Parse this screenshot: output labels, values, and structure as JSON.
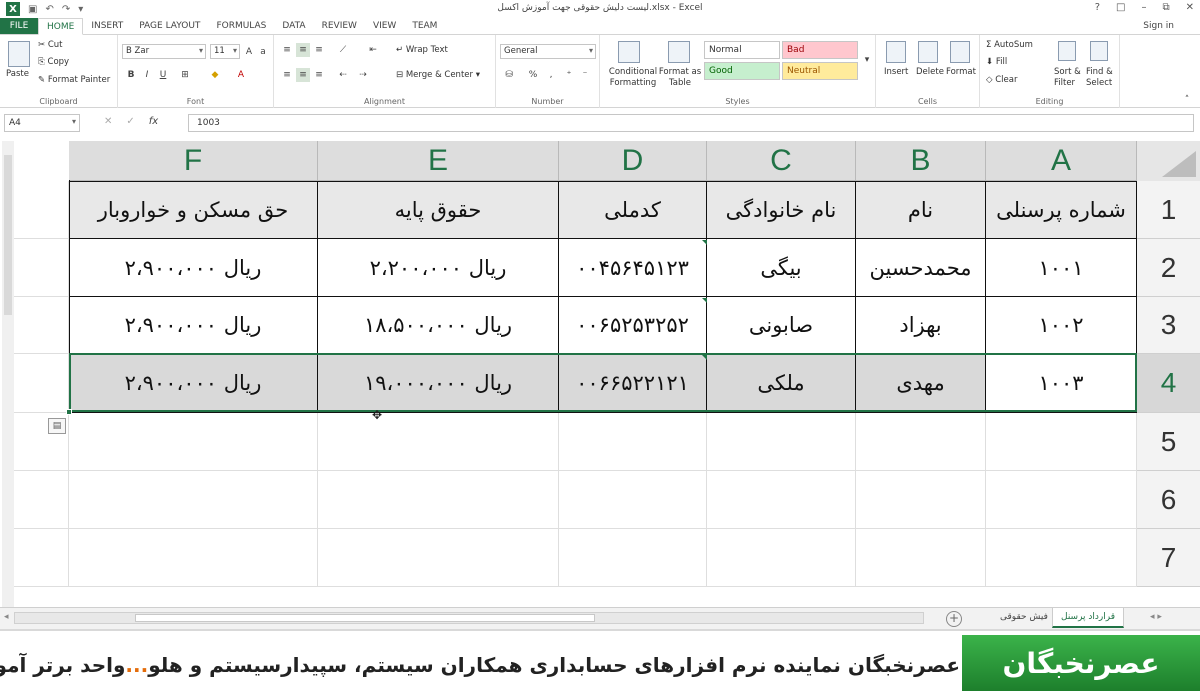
{
  "titlebar": {
    "title": "لیست دلیش حقوقی جهت آموزش اکسل.xlsx - Excel",
    "controls": [
      "?",
      "□",
      "–",
      "⧉",
      "✕"
    ]
  },
  "tabs": {
    "file": "FILE",
    "items": [
      "HOME",
      "INSERT",
      "PAGE LAYOUT",
      "FORMULAS",
      "DATA",
      "REVIEW",
      "VIEW",
      "TEAM"
    ],
    "signin": "Sign in"
  },
  "ribbon": {
    "clipboard": {
      "label": "Clipboard",
      "paste": "Paste",
      "cut": "Cut",
      "copy": "Copy",
      "format_painter": "Format Painter"
    },
    "font": {
      "label": "Font",
      "name": "B Zar",
      "size": "11"
    },
    "alignment": {
      "label": "Alignment",
      "wrap_text": "Wrap Text",
      "merge_center": "Merge & Center"
    },
    "number": {
      "label": "Number",
      "format": "General"
    },
    "styles": {
      "label": "Styles",
      "conditional_formatting": "Conditional Formatting",
      "format_as_table": "Format as Table",
      "normal": "Normal",
      "bad": "Bad",
      "good": "Good",
      "neutral": "Neutral"
    },
    "cells": {
      "label": "Cells",
      "insert": "Insert",
      "delete": "Delete",
      "format": "Format"
    },
    "editing": {
      "label": "Editing",
      "autosum": "AutoSum",
      "fill": "Fill",
      "clear": "Clear",
      "sort_filter": "Sort & Filter",
      "find_select": "Find & Select"
    }
  },
  "formula_bar": {
    "name_box": "A4",
    "content": "1003"
  },
  "grid": {
    "columns": [
      "F",
      "E",
      "D",
      "C",
      "B",
      "A"
    ],
    "rows": [
      "1",
      "2",
      "3",
      "4",
      "5",
      "6",
      "7"
    ],
    "header": [
      "حق مسکن و خواروبار",
      "حقوق پایه",
      "کدملی",
      "نام خانوادگی",
      "نام",
      "شماره پرسنلی"
    ],
    "data": [
      [
        "ریال ۲،۹۰۰،۰۰۰",
        "ریال ۲،۲۰۰،۰۰۰",
        "۰۰۴۵۶۴۵۱۲۳",
        "بیگی",
        "محمدحسین",
        "۱۰۰۱"
      ],
      [
        "ریال ۲،۹۰۰،۰۰۰",
        "ریال ۱۸،۵۰۰،۰۰۰",
        "۰۰۶۵۲۵۳۲۵۲",
        "صابونی",
        "بهزاد",
        "۱۰۰۲"
      ],
      [
        "ریال ۲،۹۰۰،۰۰۰",
        "ریال ۱۹،۰۰۰،۰۰۰",
        "۰۰۶۶۵۲۲۱۲۱",
        "ملکی",
        "مهدی",
        "۱۰۰۳"
      ]
    ]
  },
  "sheets": {
    "tabs": [
      "قرارداد پرسنل",
      "فیش حقوقی"
    ],
    "active": "قرارداد پرسنل"
  },
  "banner": {
    "ticker_prefix": "عصرنخبگان نماینده نرم افزارهای حسابداری همکاران سیستم، سپیدارسیستم و هلو",
    "ticker_dots": "...",
    "ticker_suffix": "واحد برتر آموزش ها",
    "logo": "عصرنخبگان"
  },
  "colors": {
    "excel_green": "#217346",
    "selected_row": "#d9d9d9",
    "header_fill": "#e8e8e8"
  }
}
